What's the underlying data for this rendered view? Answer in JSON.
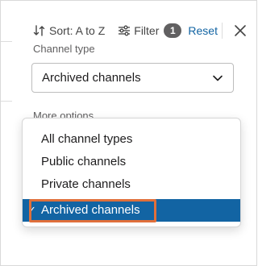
{
  "toolbar": {
    "sort_label": "Sort: A to Z",
    "filter_label": "Filter",
    "filter_count": "1",
    "reset_label": "Reset"
  },
  "channel_type": {
    "label": "Channel type",
    "selected_value": "Archived channels"
  },
  "more_options_label": "More options",
  "dropdown": {
    "options": [
      "All channel types",
      "Public channels",
      "Private channels",
      "Archived channels"
    ],
    "selected_index": 3
  },
  "colors": {
    "accent": "#1264a3",
    "badge": "#616061",
    "highlight_outline": "#e06f3a"
  },
  "icons": {
    "sort": "sort-arrows-icon",
    "filter": "sliders-icon",
    "close": "close-icon",
    "chevron": "chevron-down-icon",
    "check": "check-icon"
  }
}
